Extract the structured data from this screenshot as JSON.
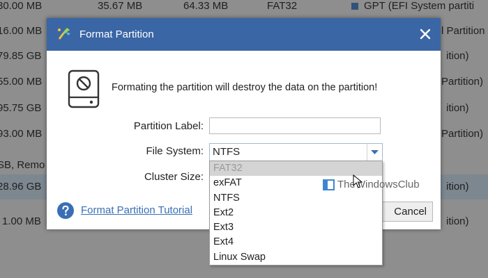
{
  "background_table": {
    "rows": [
      {
        "c1": "30.00 MB",
        "c2": "35.67 MB",
        "c3": "64.33 MB",
        "c4": "FAT32",
        "c5": "GPT (EFI System partiti",
        "square": true
      },
      {
        "c1": "16.00 MB",
        "c5": "l Partition ("
      },
      {
        "c1": "79.85 GB",
        "c5": "ition)"
      },
      {
        "c1": "55.00 MB",
        "c5": "Partition)"
      },
      {
        "c1": "95.75 GB",
        "c5": "ition)"
      },
      {
        "c1": "93.00 MB",
        "c5": "Partition)"
      },
      {
        "c1": "SB, Remo"
      },
      {
        "c1": "28.96 GB",
        "c5": "ition)",
        "selected": true
      },
      {
        "c1": "1.00 MB",
        "c5": "ition)"
      }
    ]
  },
  "dialog": {
    "title": "Format Partition",
    "warning": "Formating the partition will destroy the data on the partition!",
    "partition_label": {
      "label": "Partition Label:",
      "value": ""
    },
    "file_system": {
      "label": "File System:",
      "value": "NTFS"
    },
    "cluster_size": {
      "label": "Cluster Size:"
    },
    "tutorial_link": "Format Partition Tutorial",
    "cancel_label": "Cancel"
  },
  "dropdown": {
    "options": [
      "FAT32",
      "exFAT",
      "NTFS",
      "Ext2",
      "Ext3",
      "Ext4",
      "Linux Swap"
    ],
    "highlighted_index": 0
  },
  "watermark": {
    "text": "TheWindowsClub"
  },
  "icons": {
    "title": "format-tool-icon",
    "close": "close-icon",
    "warning": "disk-prohibited-icon",
    "dropdown_arrow": "chevron-down-icon",
    "help": "help-icon",
    "watermark": "windows-logo-icon",
    "cursor": "mouse-pointer-icon"
  },
  "colors": {
    "titlebar": "#3a66a5",
    "link": "#3a6fb5",
    "background": "#8e8e8e",
    "selected_row": "#7d8790",
    "dropdown_highlight": "#d4d4d4"
  }
}
